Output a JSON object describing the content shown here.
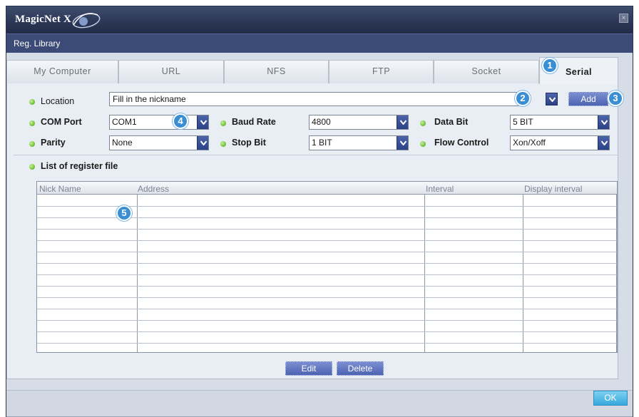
{
  "window": {
    "app_title": "MagicNet X",
    "close_glyph": "×",
    "menu_title": "Reg. Library"
  },
  "tabs": [
    {
      "label": "My Computer",
      "active": false
    },
    {
      "label": "URL",
      "active": false
    },
    {
      "label": "NFS",
      "active": false
    },
    {
      "label": "FTP",
      "active": false
    },
    {
      "label": "Socket",
      "active": false
    },
    {
      "label": "Serial",
      "active": true
    }
  ],
  "form": {
    "location": {
      "label": "Location",
      "value": "Fill in the nickname"
    },
    "add_button": "Add",
    "com_port": {
      "label": "COM Port",
      "value": "COM1"
    },
    "baud_rate": {
      "label": "Baud Rate",
      "value": "4800"
    },
    "data_bit": {
      "label": "Data Bit",
      "value": "5 BIT"
    },
    "parity": {
      "label": "Parity",
      "value": "None"
    },
    "stop_bit": {
      "label": "Stop Bit",
      "value": "1 BIT"
    },
    "flow_control": {
      "label": "Flow Control",
      "value": "Xon/Xoff"
    }
  },
  "register_list": {
    "title": "List of register file",
    "columns": [
      "Nick Name",
      "Address",
      "Interval",
      "Display interval"
    ],
    "rows": []
  },
  "buttons": {
    "edit": "Edit",
    "delete": "Delete",
    "ok": "OK"
  },
  "callouts": [
    "1",
    "2",
    "3",
    "4",
    "5"
  ],
  "colors": {
    "titlebar": "#2c3857",
    "menubar": "#3b4a76",
    "bullet": "#76c43b",
    "button": "#5a70bd",
    "callout": "#3a8fd4"
  }
}
